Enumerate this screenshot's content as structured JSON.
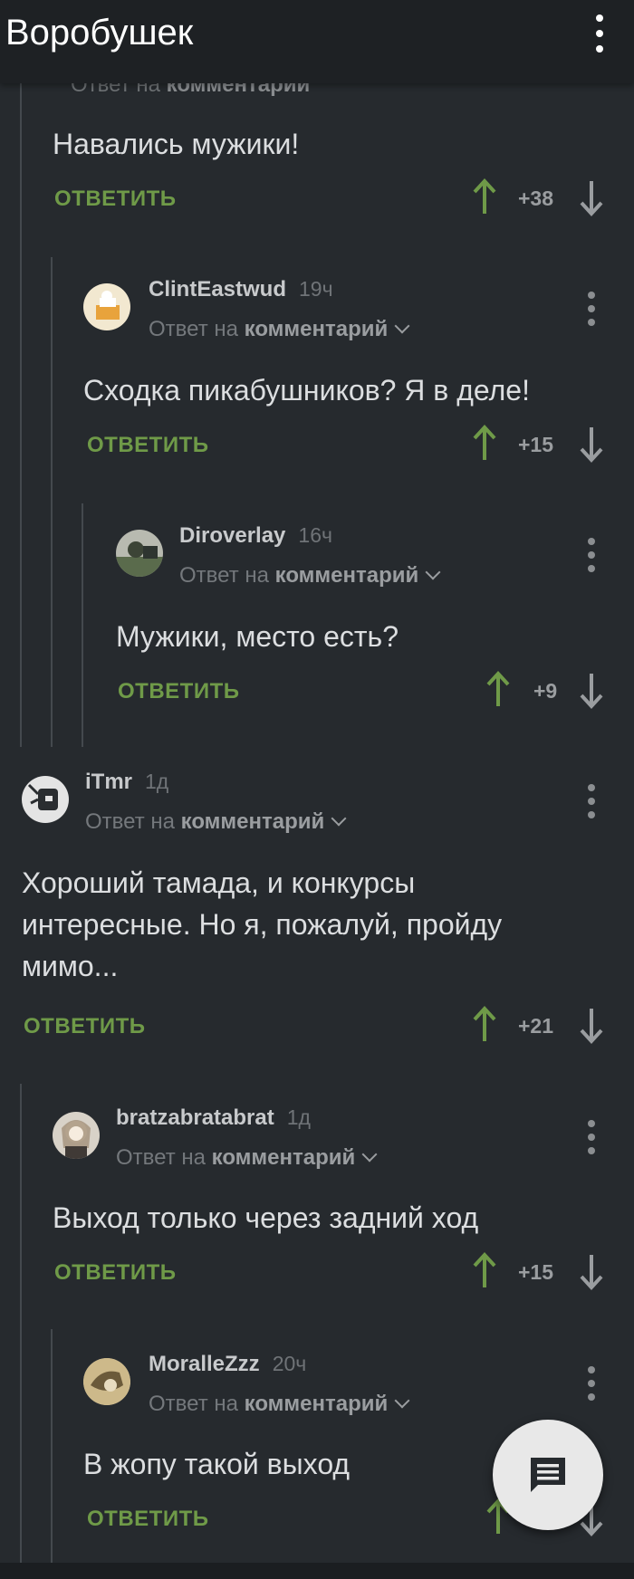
{
  "app_bar": {
    "title": "Воробушек"
  },
  "partial_row": {
    "prefix": "Ответ на",
    "target": "комментарий"
  },
  "comments": [
    {
      "username": "",
      "time": "",
      "reply_prefix": "",
      "reply_target": "",
      "body": "Навались мужики!",
      "reply_label": "ОТВЕТИТЬ",
      "score": "+38"
    },
    {
      "username": "ClintEastwud",
      "time": "19ч",
      "reply_prefix": "Ответ на",
      "reply_target": "комментарий",
      "body": "Сходка пикабушников? Я в деле!",
      "reply_label": "ОТВЕТИТЬ",
      "score": "+15"
    },
    {
      "username": "Diroverlay",
      "time": "16ч",
      "reply_prefix": "Ответ на",
      "reply_target": "комментарий",
      "body": "Мужики, место есть?",
      "reply_label": "ОТВЕТИТЬ",
      "score": "+9"
    },
    {
      "username": "iTmr",
      "time": "1д",
      "reply_prefix": "Ответ на",
      "reply_target": "комментарий",
      "body": "Хороший тамада, и конкурсы интересные. Но я, пожалуй, пройду мимо...",
      "reply_label": "ОТВЕТИТЬ",
      "score": "+21"
    },
    {
      "username": "bratzabratabrat",
      "time": "1д",
      "reply_prefix": "Ответ на",
      "reply_target": "комментарий",
      "body": "Выход только через задний ход",
      "reply_label": "ОТВЕТИТЬ",
      "score": "+15"
    },
    {
      "username": "MoralleZzz",
      "time": "20ч",
      "reply_prefix": "Ответ на",
      "reply_target": "комментарий",
      "body": "В жопу такой выход",
      "reply_label": "ОТВЕТИТЬ",
      "score": ""
    }
  ],
  "icons": {
    "upvote": "arrow-up-icon",
    "downvote": "arrow-down-icon",
    "fab": "comment-icon",
    "menu": "more-vert-icon"
  },
  "colors": {
    "background": "#262a2e",
    "appbar": "#1e2124",
    "reply_green": "#6f9a48",
    "upvote_green": "#6f9a48"
  }
}
